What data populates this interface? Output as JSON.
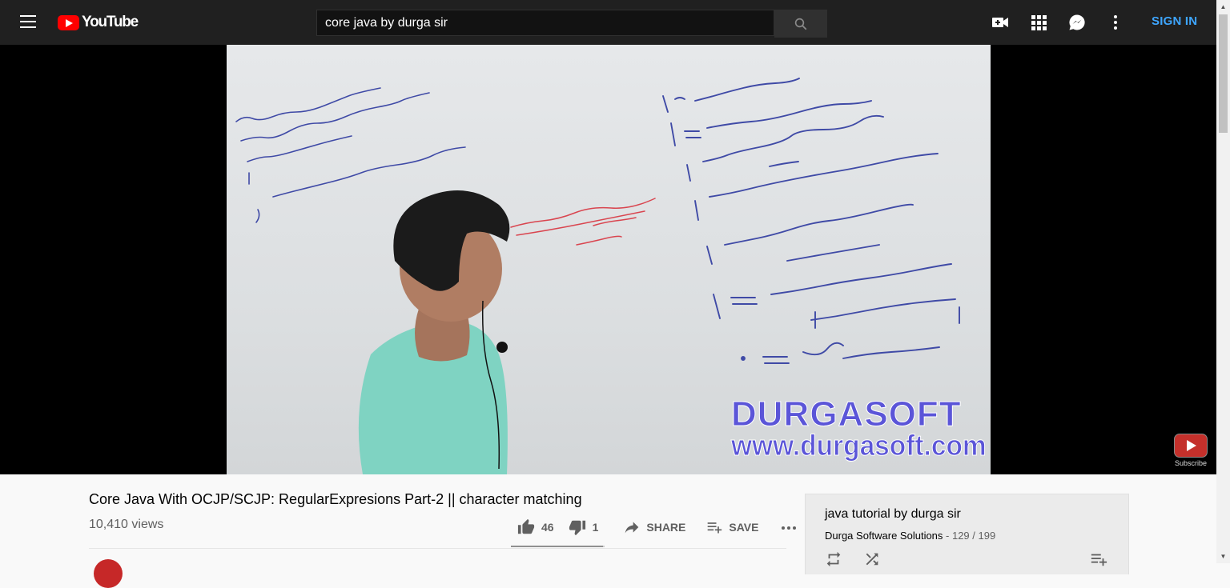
{
  "header": {
    "logo_text": "YouTube",
    "search_value": "core java by durga sir",
    "sign_in_label": "SIGN IN",
    "icons": [
      "menu-icon",
      "search-icon",
      "create-video-icon",
      "apps-grid-icon",
      "messages-icon",
      "more-vert-icon"
    ]
  },
  "video": {
    "watermark_title": "DURGASOFT",
    "watermark_url": "www.durgasoft.com",
    "subscribe_label": "Subscribe",
    "title": "Core Java With OCJP/SCJP: RegularExpresions Part-2 || character matching",
    "views": "10,410 views",
    "likes": "46",
    "dislikes": "1",
    "like_fraction": 0.98,
    "share_label": "SHARE",
    "save_label": "SAVE"
  },
  "playlist": {
    "title": "java tutorial by durga sir",
    "channel": "Durga Software Solutions",
    "position": " - 129 / 199"
  },
  "colors": {
    "topbar": "#202020",
    "accent_blue": "#3ea6ff",
    "logo_red": "#ff0000",
    "watermark": "#5b55d8"
  }
}
